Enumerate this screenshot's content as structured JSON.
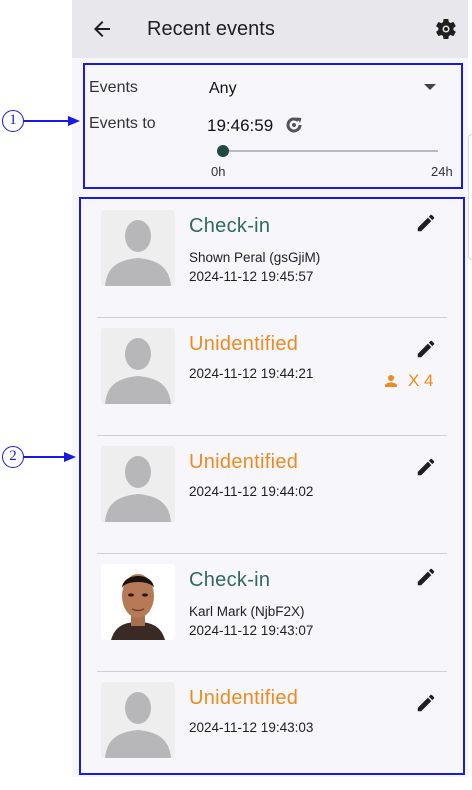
{
  "header": {
    "title": "Recent events",
    "back_icon": "arrow-left-icon",
    "settings_icon": "gear-icon"
  },
  "filter": {
    "events_label": "Events",
    "events_value": "Any",
    "events_to_label": "Events to",
    "events_to_value": "19:46:59",
    "slider_min_label": "0h",
    "slider_max_label": "24h",
    "slider_position": 0.0
  },
  "events": [
    {
      "status": "Check-in",
      "type": "checkin",
      "name": "Shown Peral (gsGjiM)",
      "time": "2024-11-12 19:45:57",
      "avatar": "placeholder"
    },
    {
      "status": "Unidentified",
      "type": "unid",
      "name": "",
      "time": "2024-11-12 19:44:21",
      "count": "X 4",
      "avatar": "placeholder"
    },
    {
      "status": "Unidentified",
      "type": "unid",
      "name": "",
      "time": "2024-11-12 19:44:02",
      "avatar": "placeholder"
    },
    {
      "status": "Check-in",
      "type": "checkin",
      "name": "Karl Mark (NjbF2X)",
      "time": "2024-11-12 19:43:07",
      "avatar": "photo"
    },
    {
      "status": "Unidentified",
      "type": "unid",
      "name": "",
      "time": "2024-11-12 19:43:03",
      "avatar": "placeholder"
    }
  ],
  "annotations": {
    "callout_1": "1",
    "callout_2": "2"
  },
  "colors": {
    "checkin": "#2f6a5c",
    "unidentified": "#ef8a1f",
    "annotation": "#1a1ae6",
    "appbar": "#e7e7ec"
  }
}
